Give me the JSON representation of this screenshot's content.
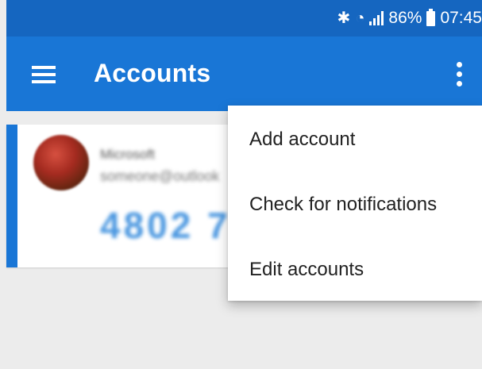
{
  "status_bar": {
    "bluetooth_icon": "bluetooth-icon",
    "wifi_icon": "wifi-icon",
    "signal_icon": "signal-icon",
    "battery_percent": "86%",
    "battery_icon": "battery-icon",
    "time": "07:45"
  },
  "app_bar": {
    "menu_icon": "hamburger-menu-icon",
    "title": "Accounts",
    "overflow_icon": "more-vert-icon",
    "color": "#1976d6"
  },
  "accounts": [
    {
      "avatar": "account-avatar",
      "issuer": "Microsoft",
      "username": "someone@outlook",
      "code": "4802 7"
    }
  ],
  "overflow_menu": {
    "items": [
      {
        "label": "Add account"
      },
      {
        "label": "Check for notifications"
      },
      {
        "label": "Edit accounts"
      }
    ]
  },
  "colors": {
    "status_bar": "#1566c0",
    "accent": "#1976d6",
    "background": "#ececec",
    "code_text": "#4a97e0"
  }
}
